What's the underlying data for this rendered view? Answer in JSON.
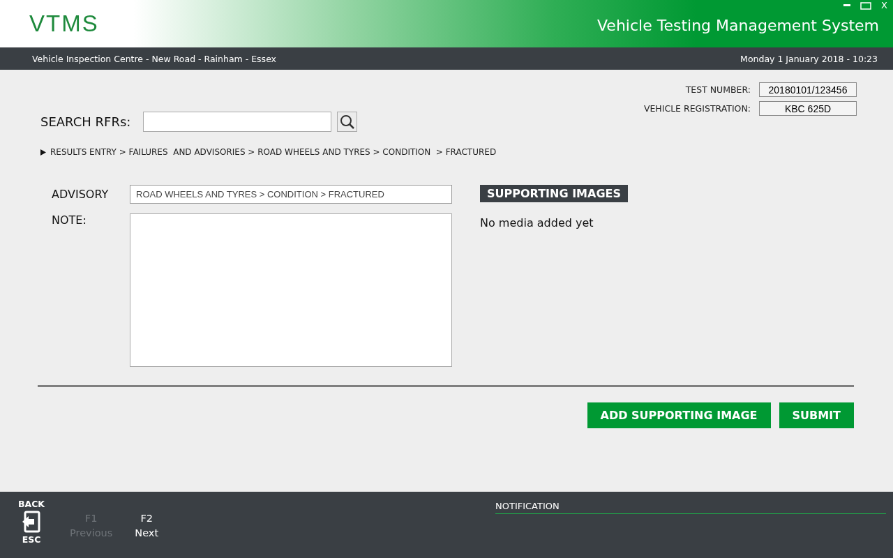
{
  "header": {
    "logo": "VTMS",
    "title": "Vehicle Testing Management System",
    "close_label": "X"
  },
  "info_bar": {
    "location": "Vehicle Inspection Centre - New Road - Rainham - Essex",
    "datetime": "Monday 1 January 2018 - 10:23"
  },
  "test_info": [
    {
      "label": "TEST NUMBER:",
      "value": "20180101/123456"
    },
    {
      "label": "VEHICLE REGISTRATION:",
      "value": "KBC 625D"
    }
  ],
  "search": {
    "label": "SEARCH RFRs:"
  },
  "breadcrumb": "RESULTS ENTRY > FAILURES  AND ADVISORIES > ROAD WHEELS AND TYRES > CONDITION  > FRACTURED",
  "form": {
    "advisory_label": "ADVISORY",
    "advisory_value": "ROAD WHEELS AND TYRES > CONDITION > FRACTURED",
    "note_label": "NOTE:"
  },
  "supporting_images": {
    "title": "SUPPORTING IMAGES",
    "empty_text": "No media added yet"
  },
  "buttons": [
    "ADD SUPPORTING IMAGE",
    "SUBMIT"
  ],
  "footer": {
    "back": {
      "top": "BACK",
      "bottom": "ESC"
    },
    "keys": [
      {
        "key": "F1",
        "label": "Previous",
        "disabled": true
      },
      {
        "key": "F2",
        "label": "Next",
        "disabled": false
      }
    ],
    "notification_title": "NOTIFICATION"
  }
}
